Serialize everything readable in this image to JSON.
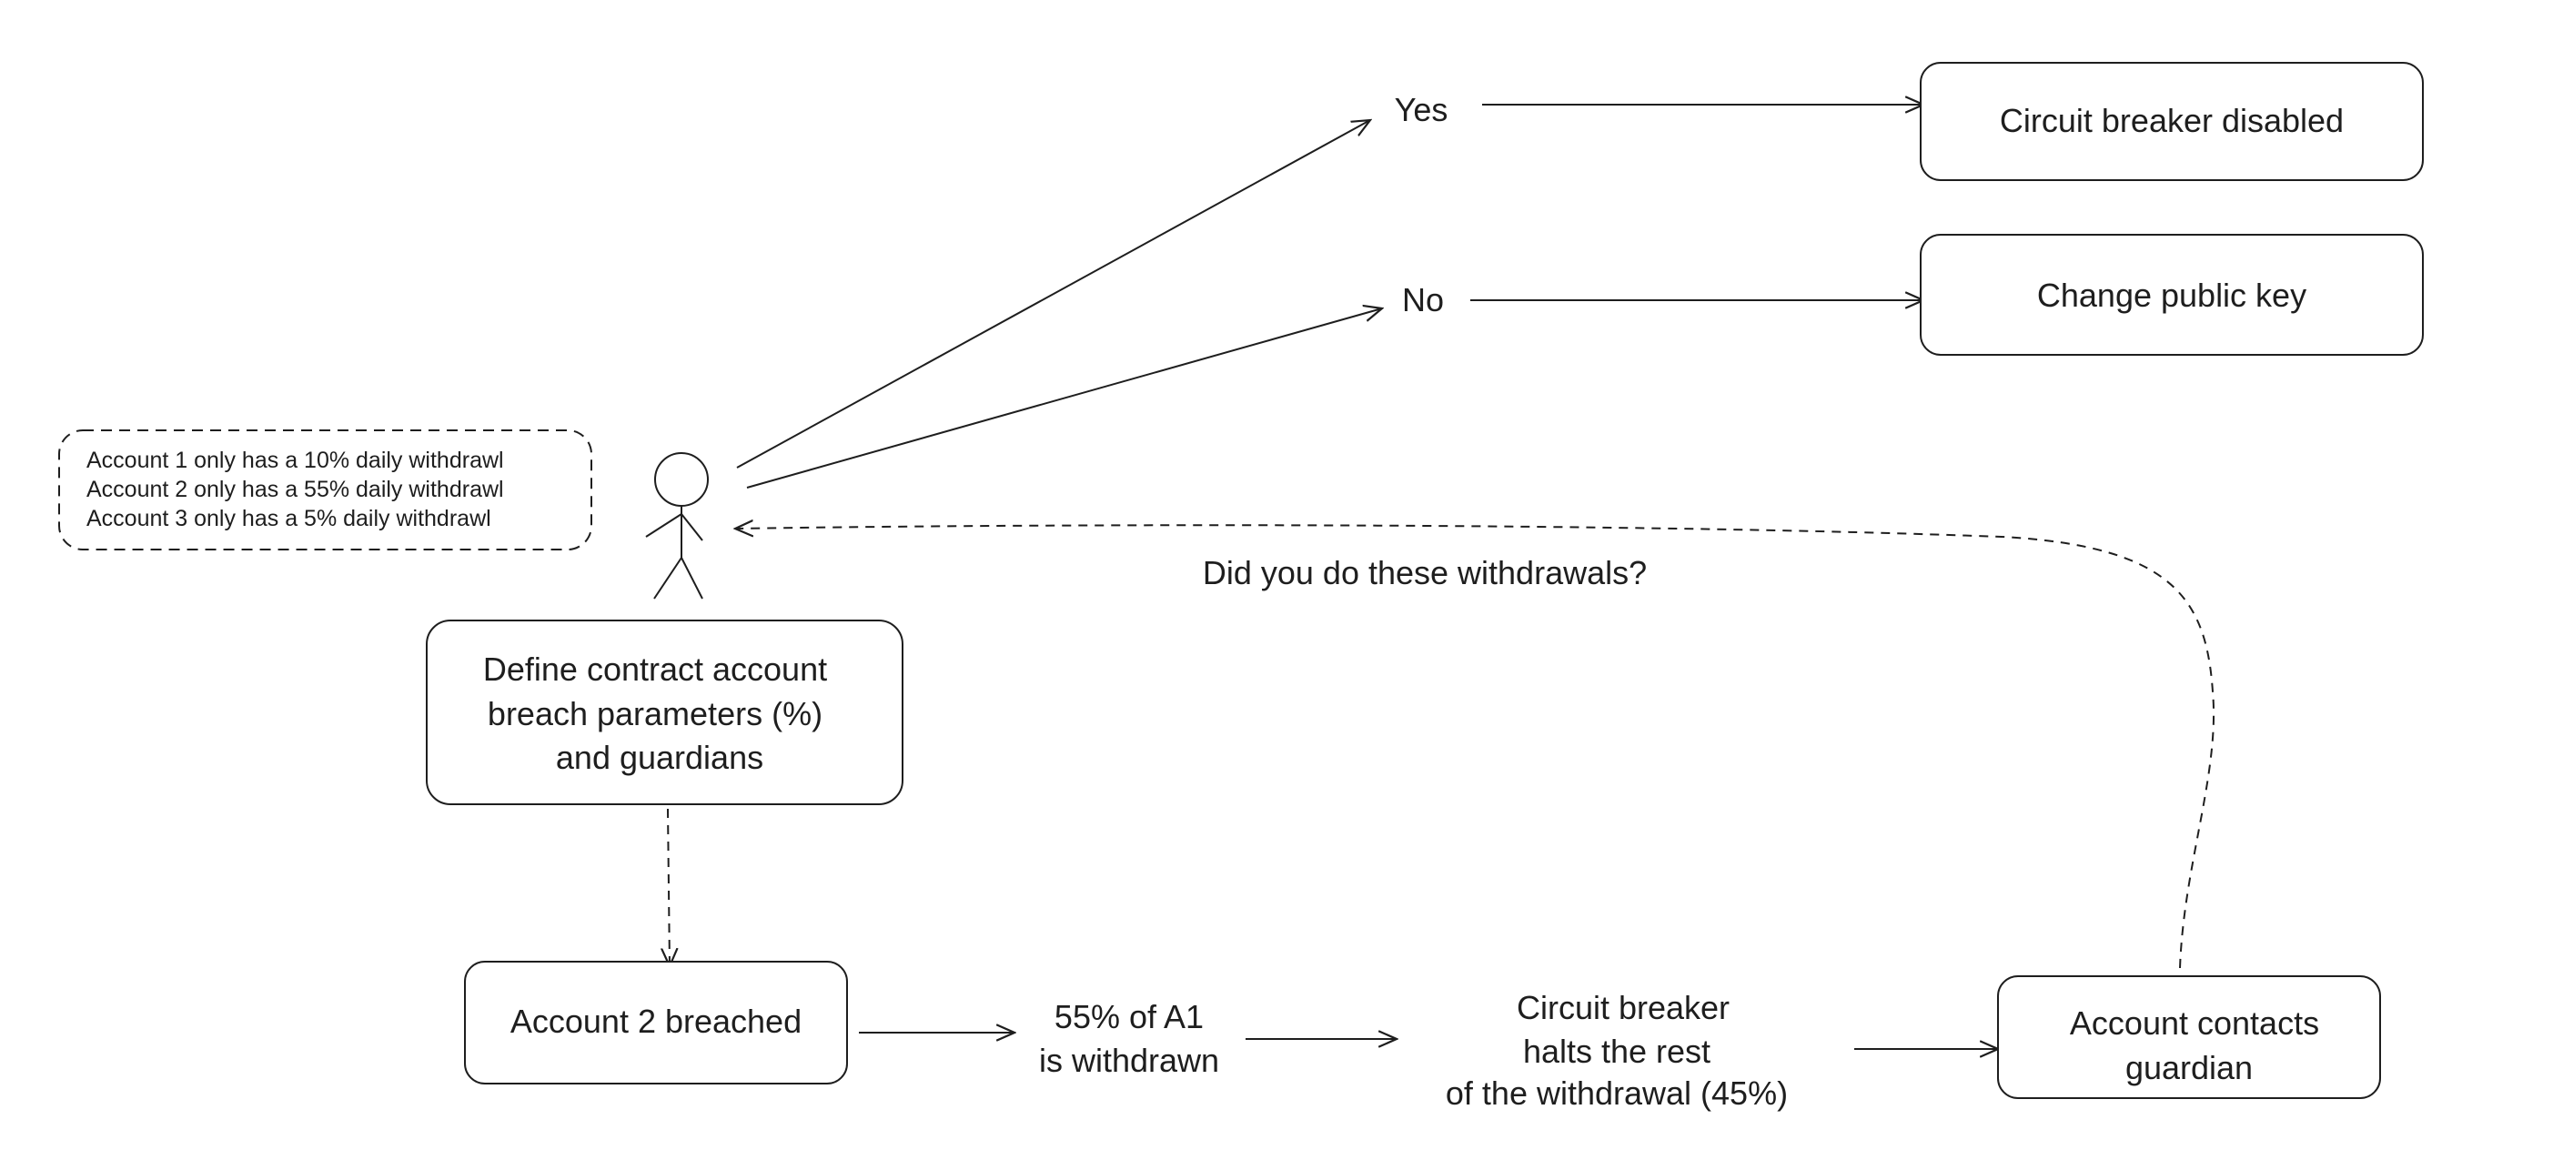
{
  "nodes": {
    "yes": "Yes",
    "no": "No",
    "circuit_disabled": "Circuit breaker disabled",
    "change_key": "Change public key",
    "note": [
      "Account 1 only has a 10% daily withdrawl",
      "Account 2 only has a 55% daily withdrawl",
      "Account 3 only has a 5% daily withdrawl"
    ],
    "define": [
      "Define contract account",
      "breach parameters (%)",
      "and guardians"
    ],
    "breached": "Account 2 breached",
    "withdrawn": [
      "55% of A1",
      "is withdrawn"
    ],
    "halts": [
      "Circuit breaker",
      "halts the rest",
      "of the withdrawal (45%)"
    ],
    "contacts": [
      "Account contacts",
      "guardian"
    ],
    "question": "Did you do these withdrawals?"
  }
}
